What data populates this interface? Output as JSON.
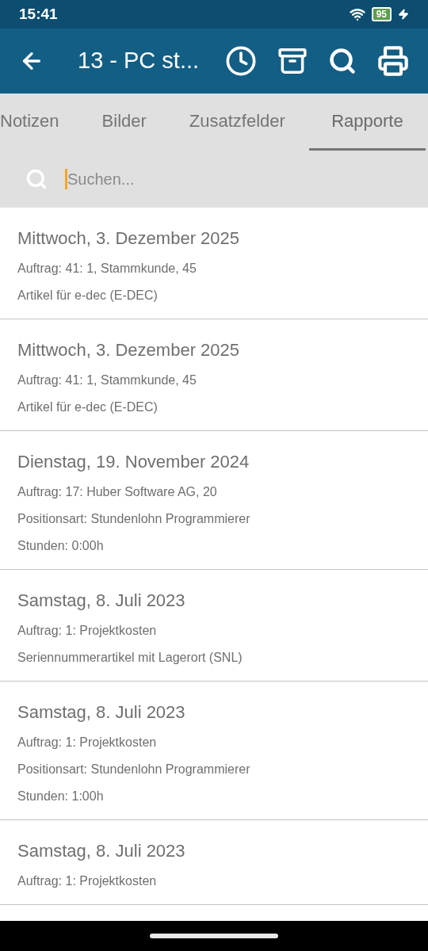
{
  "status_bar": {
    "time": "15:41",
    "battery": "95"
  },
  "app_bar": {
    "title": "13 - PC st..."
  },
  "tabs": [
    {
      "label": "Notizen",
      "selected": false
    },
    {
      "label": "Bilder",
      "selected": false
    },
    {
      "label": "Zusatzfelder",
      "selected": false
    },
    {
      "label": "Rapporte",
      "selected": true
    }
  ],
  "search": {
    "placeholder": "Suchen..."
  },
  "reports": [
    {
      "date": "Mittwoch, 3. Dezember 2025",
      "lines": [
        "Auftrag: 41: 1, Stammkunde, 45",
        "Artikel für e-dec (E-DEC)"
      ]
    },
    {
      "date": "Mittwoch, 3. Dezember 2025",
      "lines": [
        "Auftrag: 41: 1, Stammkunde, 45",
        "Artikel für e-dec (E-DEC)"
      ]
    },
    {
      "date": "Dienstag, 19. November 2024",
      "lines": [
        "Auftrag: 17: Huber Software AG, 20",
        "Positionsart: Stundenlohn Programmierer",
        "Stunden: 0:00h"
      ]
    },
    {
      "date": "Samstag, 8. Juli 2023",
      "lines": [
        "Auftrag: 1: Projektkosten",
        "Seriennummerartikel mit Lagerort (SNL)"
      ]
    },
    {
      "date": "Samstag, 8. Juli 2023",
      "lines": [
        "Auftrag: 1: Projektkosten",
        "Positionsart: Stundenlohn Programmierer",
        "Stunden: 1:00h"
      ]
    },
    {
      "date": "Samstag, 8. Juli 2023",
      "lines": [
        "Auftrag: 1: Projektkosten"
      ]
    }
  ]
}
